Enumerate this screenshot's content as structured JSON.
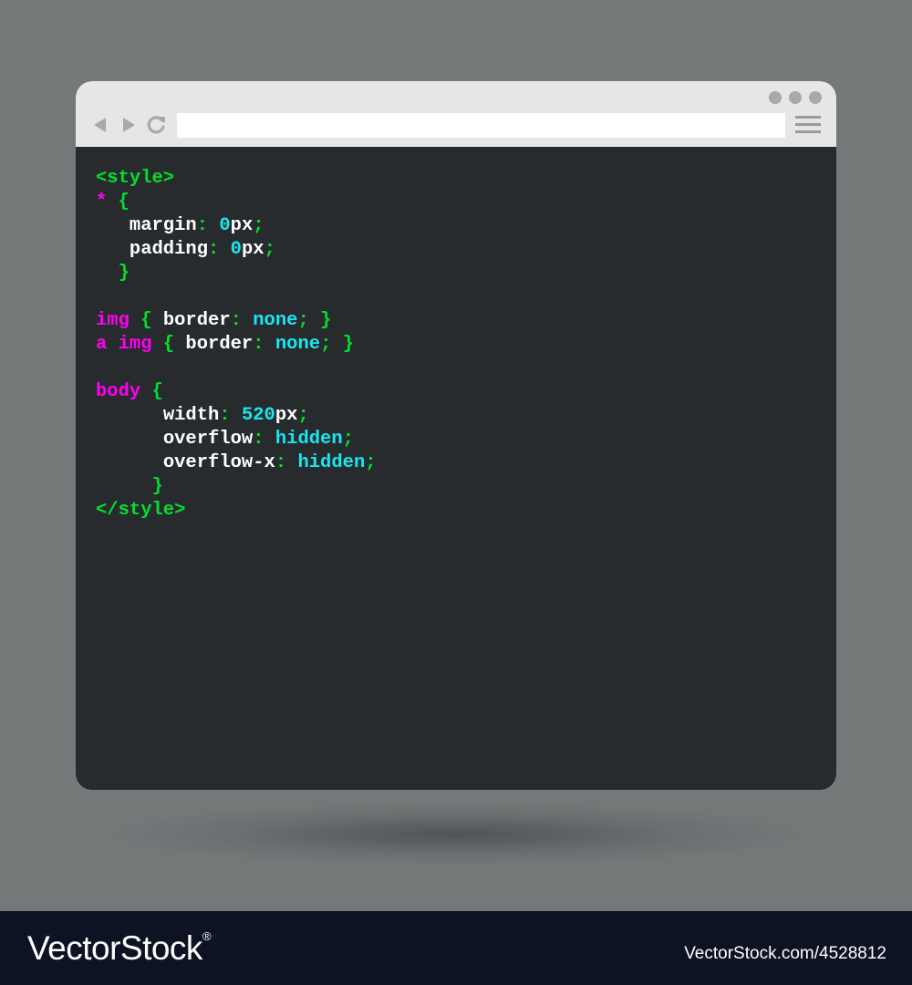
{
  "colors": {
    "background": "#737879",
    "window_bg": "#282b2e",
    "titlebar": "#e6e6e6",
    "tag_green": "#00e02c",
    "selector_magenta": "#ff00f0",
    "property_white": "#ffffff",
    "value_cyan": "#19e6f0",
    "footer_bg": "#0d1323"
  },
  "browser": {
    "window_dots": [
      "dot",
      "dot",
      "dot"
    ],
    "nav": {
      "back_icon": "back-arrow-icon",
      "forward_icon": "forward-arrow-icon",
      "reload_icon": "reload-icon",
      "menu_icon": "hamburger-menu-icon"
    },
    "url": {
      "value": "",
      "placeholder": ""
    }
  },
  "code": {
    "lines": [
      {
        "indent": "",
        "tokens": [
          {
            "t": "<style>",
            "c": "g"
          }
        ]
      },
      {
        "indent": "",
        "tokens": [
          {
            "t": "*",
            "c": "m"
          },
          {
            "t": " {",
            "c": "g"
          }
        ]
      },
      {
        "indent": "   ",
        "tokens": [
          {
            "t": "margin",
            "c": "w"
          },
          {
            "t": ": ",
            "c": "g"
          },
          {
            "t": "0",
            "c": "c"
          },
          {
            "t": "px",
            "c": "w"
          },
          {
            "t": ";",
            "c": "g"
          }
        ]
      },
      {
        "indent": "   ",
        "tokens": [
          {
            "t": "padding",
            "c": "w"
          },
          {
            "t": ": ",
            "c": "g"
          },
          {
            "t": "0",
            "c": "c"
          },
          {
            "t": "px",
            "c": "w"
          },
          {
            "t": ";",
            "c": "g"
          }
        ]
      },
      {
        "indent": "  ",
        "tokens": [
          {
            "t": "}",
            "c": "g"
          }
        ]
      },
      {
        "indent": "",
        "tokens": []
      },
      {
        "indent": "",
        "tokens": [
          {
            "t": "img",
            "c": "m"
          },
          {
            "t": " { ",
            "c": "g"
          },
          {
            "t": "border",
            "c": "w"
          },
          {
            "t": ": ",
            "c": "g"
          },
          {
            "t": "none",
            "c": "c"
          },
          {
            "t": "; }",
            "c": "g"
          }
        ]
      },
      {
        "indent": "",
        "tokens": [
          {
            "t": "a img",
            "c": "m"
          },
          {
            "t": " { ",
            "c": "g"
          },
          {
            "t": "border",
            "c": "w"
          },
          {
            "t": ": ",
            "c": "g"
          },
          {
            "t": "none",
            "c": "c"
          },
          {
            "t": "; }",
            "c": "g"
          }
        ]
      },
      {
        "indent": "",
        "tokens": []
      },
      {
        "indent": "",
        "tokens": [
          {
            "t": "body",
            "c": "m"
          },
          {
            "t": " {",
            "c": "g"
          }
        ]
      },
      {
        "indent": "      ",
        "tokens": [
          {
            "t": "width",
            "c": "w"
          },
          {
            "t": ": ",
            "c": "g"
          },
          {
            "t": "520",
            "c": "c"
          },
          {
            "t": "px",
            "c": "w"
          },
          {
            "t": ";",
            "c": "g"
          }
        ]
      },
      {
        "indent": "      ",
        "tokens": [
          {
            "t": "overflow",
            "c": "w"
          },
          {
            "t": ": ",
            "c": "g"
          },
          {
            "t": "hidden",
            "c": "c"
          },
          {
            "t": ";",
            "c": "g"
          }
        ]
      },
      {
        "indent": "      ",
        "tokens": [
          {
            "t": "overflow-x",
            "c": "w"
          },
          {
            "t": ": ",
            "c": "g"
          },
          {
            "t": "hidden",
            "c": "c"
          },
          {
            "t": ";",
            "c": "g"
          }
        ]
      },
      {
        "indent": "     ",
        "tokens": [
          {
            "t": "}",
            "c": "g"
          }
        ]
      },
      {
        "indent": "",
        "tokens": [
          {
            "t": "</style>",
            "c": "g"
          }
        ]
      }
    ]
  },
  "footer": {
    "brand": "VectorStock",
    "brand_mark": "®",
    "stock_id": "VectorStock.com/4528812"
  }
}
